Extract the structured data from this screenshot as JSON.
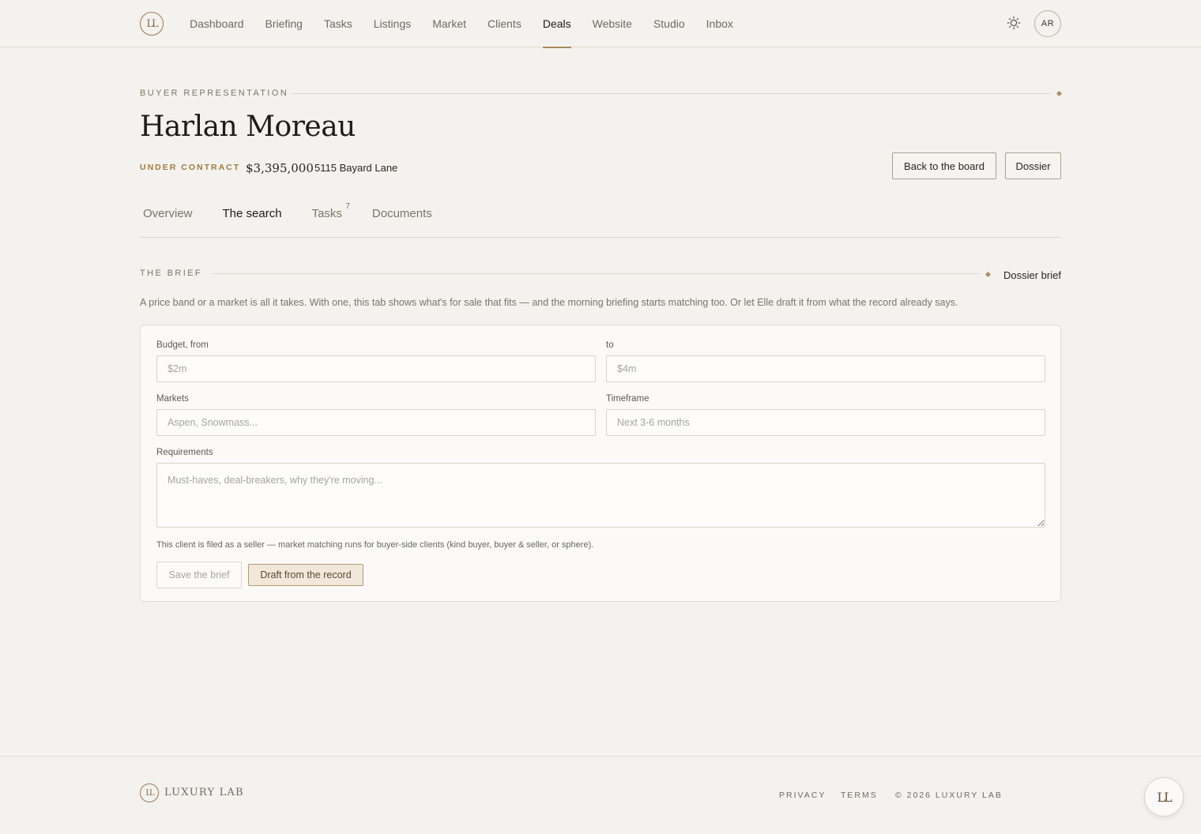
{
  "brand": {
    "mark": "LL",
    "name": "LUXURY LAB"
  },
  "nav": {
    "items": [
      "Dashboard",
      "Briefing",
      "Tasks",
      "Listings",
      "Market",
      "Clients",
      "Deals",
      "Website",
      "Studio",
      "Inbox"
    ],
    "active": "Deals",
    "avatar_initials": "AR",
    "theme_icon": "sun-icon"
  },
  "header": {
    "eyebrow": "BUYER REPRESENTATION",
    "title": "Harlan Moreau",
    "status": "UNDER CONTRACT",
    "price": "$3,395,000",
    "address": "5115 Bayard Lane",
    "back_button": "Back to the board",
    "dossier_button": "Dossier"
  },
  "tabs": {
    "overview": "Overview",
    "search": "The search",
    "tasks": "Tasks",
    "tasks_count": "7",
    "documents": "Documents",
    "active": "The search"
  },
  "brief": {
    "eyebrow": "THE BRIEF",
    "dossier_link": "Dossier brief",
    "intro": "A price band or a market is all it takes. With one, this tab shows what's for sale that fits — and the morning briefing starts matching too. Or let Elle draft it from what the record already says.",
    "budget_from_label": "Budget, from",
    "budget_from_placeholder": "$2m",
    "budget_to_label": "to",
    "budget_to_placeholder": "$4m",
    "markets_label": "Markets",
    "markets_placeholder": "Aspen, Snowmass...",
    "timeframe_label": "Timeframe",
    "timeframe_placeholder": "Next 3-6 months",
    "requirements_label": "Requirements",
    "requirements_placeholder": "Must-haves, deal-breakers, why they're moving...",
    "note": "This client is filed as a seller — market matching runs for buyer-side clients (kind buyer, buyer & seller, or sphere).",
    "save_button": "Save the brief",
    "draft_button": "Draft from the record"
  },
  "footer": {
    "privacy": "PRIVACY",
    "terms": "TERMS",
    "copyright": "© 2026 LUXURY LAB"
  },
  "colors": {
    "accent": "#b08d5f",
    "background": "#f4f2ee",
    "status": "#a0793e"
  }
}
